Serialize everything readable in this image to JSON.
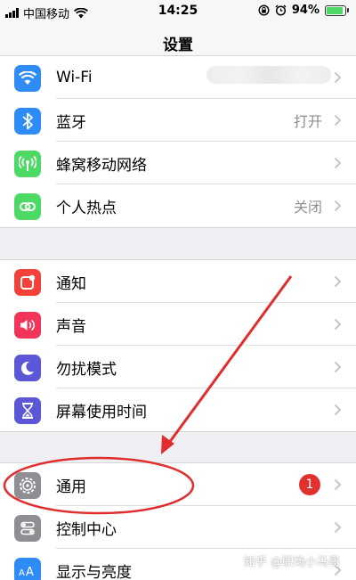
{
  "status": {
    "carrier": "中国移动",
    "time": "14:25",
    "battery": "94%"
  },
  "nav": {
    "title": "设置"
  },
  "group1": [
    {
      "label": "Wi-Fi",
      "value": "",
      "icon": "wifi-icon",
      "color": "#2f8cf7"
    },
    {
      "label": "蓝牙",
      "value": "打开",
      "icon": "bluetooth-icon",
      "color": "#2f8cf7"
    },
    {
      "label": "蜂窝移动网络",
      "value": "",
      "icon": "cellular-icon",
      "color": "#4cd964"
    },
    {
      "label": "个人热点",
      "value": "关闭",
      "icon": "hotspot-icon",
      "color": "#4cd964"
    }
  ],
  "group2": [
    {
      "label": "通知",
      "icon": "notifications-icon",
      "color": "#f3423a"
    },
    {
      "label": "声音",
      "icon": "sound-icon",
      "color": "#f2345a"
    },
    {
      "label": "勿扰模式",
      "icon": "moon-icon",
      "color": "#5b57d6"
    },
    {
      "label": "屏幕使用时间",
      "icon": "hourglass-icon",
      "color": "#5b57d6"
    }
  ],
  "group3": [
    {
      "label": "通用",
      "badge": "1",
      "icon": "gear-icon",
      "color": "#8e8e93"
    },
    {
      "label": "控制中心",
      "icon": "control-center-icon",
      "color": "#8e8e93"
    },
    {
      "label": "显示与亮度",
      "icon": "display-icon",
      "color": "#2f8cf7"
    }
  ],
  "watermark": "知乎 @职场小马哥"
}
